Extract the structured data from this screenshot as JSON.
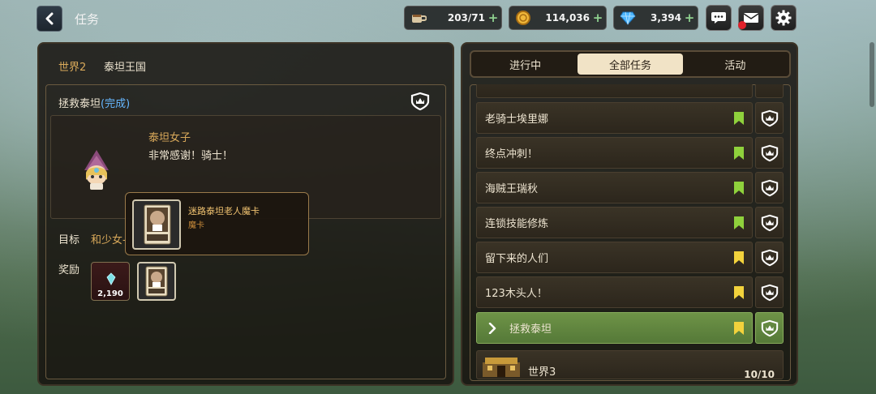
{
  "header": {
    "title": "任务",
    "resources": [
      {
        "icon": "coffee-cup-icon",
        "value": "203/71"
      },
      {
        "icon": "gold-coin-icon",
        "value": "114,036"
      },
      {
        "icon": "diamond-icon",
        "value": "3,394"
      }
    ]
  },
  "left_panel": {
    "breadcrumb": {
      "world": "世界2",
      "region": "泰坦王国"
    },
    "quest": {
      "title": "拯救泰坦",
      "status": "(完成)"
    },
    "npc": {
      "name": "泰坦女子",
      "speech": "非常感谢！骑士！"
    },
    "objective": {
      "label": "目标",
      "text": "和少女-"
    },
    "rewards": {
      "label": "奖励",
      "crystal_amount": "2,190"
    },
    "tooltip": {
      "title": "迷路泰坦老人魔卡",
      "subtitle": "魔卡"
    }
  },
  "right_panel": {
    "tabs": [
      {
        "label": "进行中",
        "active": false
      },
      {
        "label": "全部任务",
        "active": true
      },
      {
        "label": "活动",
        "active": false
      }
    ],
    "quests": [
      {
        "name": "老骑士埃里娜",
        "bookmark_color": "#8fd13c"
      },
      {
        "name": "终点冲刺！",
        "bookmark_color": "#8fd13c"
      },
      {
        "name": "海贼王瑞秋",
        "bookmark_color": "#8fd13c"
      },
      {
        "name": "连锁技能修炼",
        "bookmark_color": "#8fd13c"
      },
      {
        "name": "留下来的人们",
        "bookmark_color": "#f2d23c"
      },
      {
        "name": "123木头人！",
        "bookmark_color": "#f2d23c"
      },
      {
        "name": "拯救泰坦",
        "bookmark_color": "#f2d23c",
        "active": true
      }
    ],
    "world": {
      "name": "世界3",
      "progress": "10/10"
    }
  },
  "colors": {
    "accent_green": "#6e9347",
    "gold_text": "#d9a95a",
    "status_blue": "#66b7ff"
  }
}
